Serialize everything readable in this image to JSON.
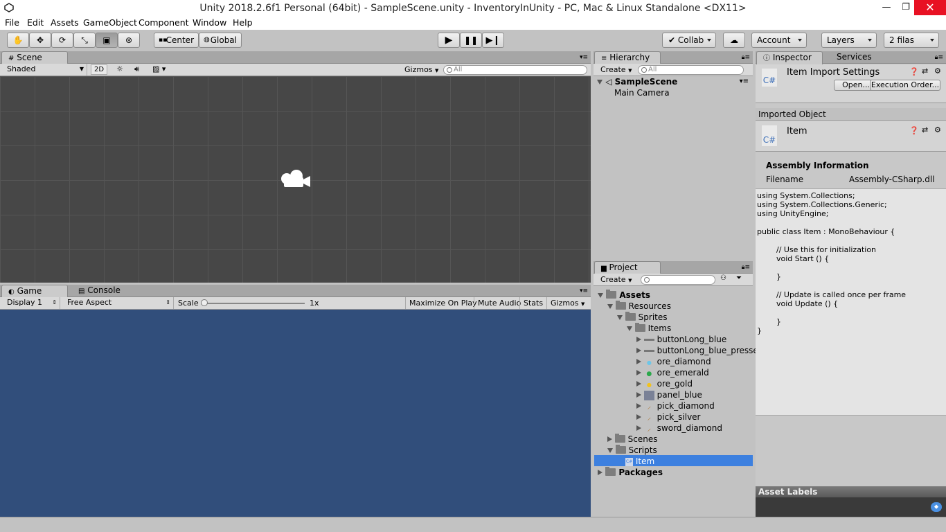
{
  "window": {
    "title": "Unity 2018.2.6f1 Personal (64bit) - SampleScene.unity - InventoryInUnity - PC, Mac & Linux Standalone <DX11>",
    "minimize": "—",
    "restore": "❐",
    "close": "✕"
  },
  "menu": [
    "File",
    "Edit",
    "Assets",
    "GameObject",
    "Component",
    "Window",
    "Help"
  ],
  "toolbar": {
    "center": "Center",
    "global": "Global",
    "collab": "Collab",
    "account": "Account",
    "layers": "Layers",
    "layout": "2 filas"
  },
  "scene": {
    "tab": "Scene",
    "shading": "Shaded",
    "mode2d": "2D",
    "gizmos": "Gizmos",
    "search_placeholder": "All"
  },
  "game": {
    "tab": "Game",
    "console_tab": "Console",
    "display": "Display 1",
    "aspect": "Free Aspect",
    "scale_label": "Scale",
    "scale_value": "1x",
    "maximize": "Maximize On Play",
    "mute": "Mute Audio",
    "stats": "Stats",
    "gizmos": "Gizmos",
    "bg_color": "#314e7b"
  },
  "hierarchy": {
    "tab": "Hierarchy",
    "create": "Create",
    "search_placeholder": "All",
    "scene": "SampleScene",
    "items": [
      "Main Camera"
    ]
  },
  "project": {
    "tab": "Project",
    "create": "Create",
    "tree": [
      {
        "label": "Assets",
        "bold": true
      },
      {
        "label": "Resources"
      },
      {
        "label": "Sprites"
      },
      {
        "label": "Items"
      },
      {
        "label": "buttonLong_blue"
      },
      {
        "label": "buttonLong_blue_presse"
      },
      {
        "label": "ore_diamond"
      },
      {
        "label": "ore_emerald"
      },
      {
        "label": "ore_gold"
      },
      {
        "label": "panel_blue"
      },
      {
        "label": "pick_diamond"
      },
      {
        "label": "pick_silver"
      },
      {
        "label": "sword_diamond"
      },
      {
        "label": "Scenes"
      },
      {
        "label": "Scripts"
      },
      {
        "label": "Item"
      },
      {
        "label": "Packages",
        "bold": true
      }
    ]
  },
  "inspector": {
    "tab": "Inspector",
    "services_tab": "Services",
    "header_title": "Item Import Settings",
    "open": "Open...",
    "execution_order": "Execution Order...",
    "imported_object": "Imported Object",
    "object_name": "Item",
    "script_icon": "C#",
    "assembly_info": "Assembly Information",
    "filename_label": "Filename",
    "filename_value": "Assembly-CSharp.dll",
    "code": "using System.Collections;\nusing System.Collections.Generic;\nusing UnityEngine;\n\npublic class Item : MonoBehaviour {\n\n\t// Use this for initialization\n\tvoid Start () {\n\t\t\n\t}\n\t\n\t// Update is called once per frame\n\tvoid Update () {\n\t\t\n\t}\n}",
    "asset_labels": "Asset Labels"
  },
  "colors": {
    "selection": "#3d80df",
    "scene_bg": "#474747"
  }
}
